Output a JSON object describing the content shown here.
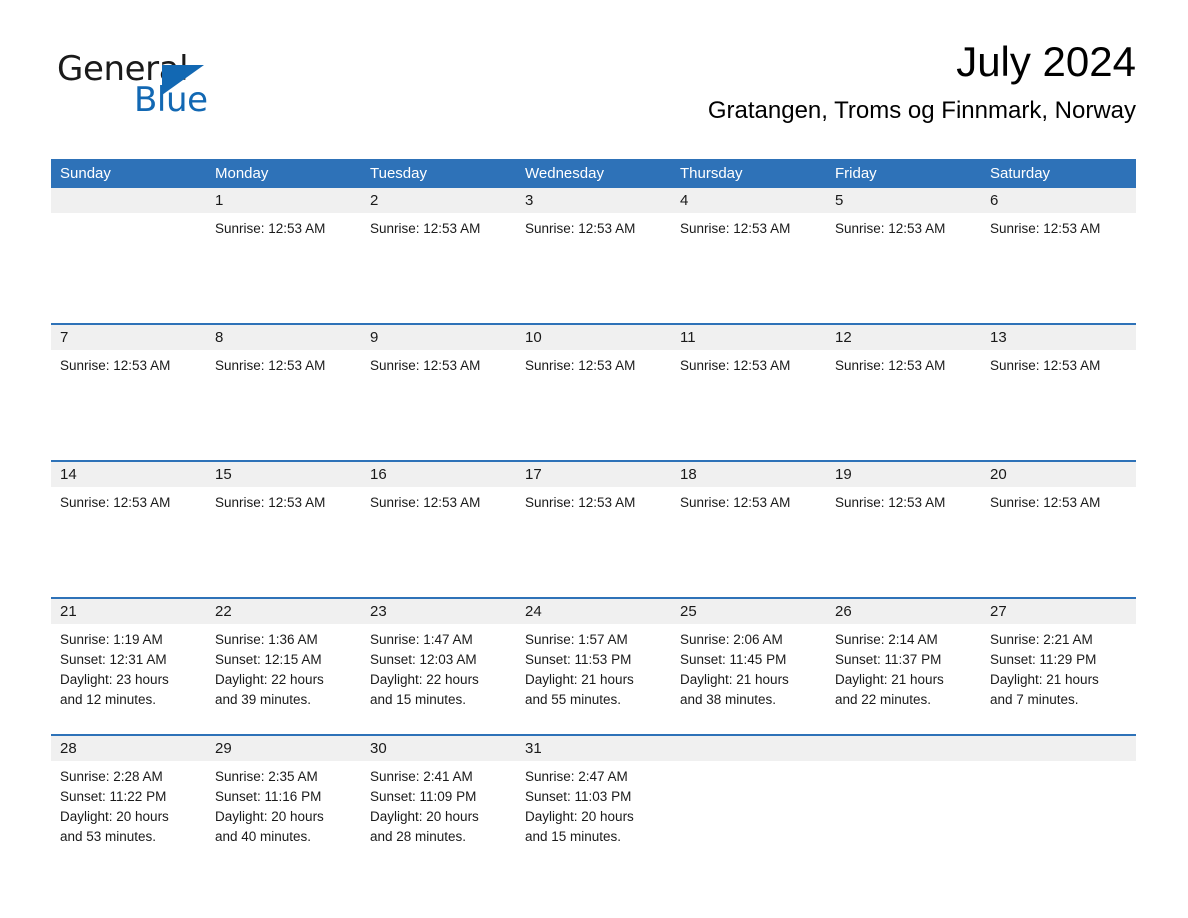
{
  "brand": {
    "name_part1": "General",
    "name_part2": "Blue",
    "triangle_color": "#1268b3",
    "accent_color": "#2e72b8"
  },
  "header": {
    "title": "July 2024",
    "subtitle": "Gratangen, Troms og Finnmark, Norway"
  },
  "calendar": {
    "weekday_headers": [
      "Sunday",
      "Monday",
      "Tuesday",
      "Wednesday",
      "Thursday",
      "Friday",
      "Saturday"
    ],
    "header_bg": "#2e72b8",
    "datebar_bg": "#f0f0f0",
    "weeks": [
      [
        {
          "date": "",
          "lines": []
        },
        {
          "date": "1",
          "lines": [
            "Sunrise: 12:53 AM"
          ]
        },
        {
          "date": "2",
          "lines": [
            "Sunrise: 12:53 AM"
          ]
        },
        {
          "date": "3",
          "lines": [
            "Sunrise: 12:53 AM"
          ]
        },
        {
          "date": "4",
          "lines": [
            "Sunrise: 12:53 AM"
          ]
        },
        {
          "date": "5",
          "lines": [
            "Sunrise: 12:53 AM"
          ]
        },
        {
          "date": "6",
          "lines": [
            "Sunrise: 12:53 AM"
          ]
        }
      ],
      [
        {
          "date": "7",
          "lines": [
            "Sunrise: 12:53 AM"
          ]
        },
        {
          "date": "8",
          "lines": [
            "Sunrise: 12:53 AM"
          ]
        },
        {
          "date": "9",
          "lines": [
            "Sunrise: 12:53 AM"
          ]
        },
        {
          "date": "10",
          "lines": [
            "Sunrise: 12:53 AM"
          ]
        },
        {
          "date": "11",
          "lines": [
            "Sunrise: 12:53 AM"
          ]
        },
        {
          "date": "12",
          "lines": [
            "Sunrise: 12:53 AM"
          ]
        },
        {
          "date": "13",
          "lines": [
            "Sunrise: 12:53 AM"
          ]
        }
      ],
      [
        {
          "date": "14",
          "lines": [
            "Sunrise: 12:53 AM"
          ]
        },
        {
          "date": "15",
          "lines": [
            "Sunrise: 12:53 AM"
          ]
        },
        {
          "date": "16",
          "lines": [
            "Sunrise: 12:53 AM"
          ]
        },
        {
          "date": "17",
          "lines": [
            "Sunrise: 12:53 AM"
          ]
        },
        {
          "date": "18",
          "lines": [
            "Sunrise: 12:53 AM"
          ]
        },
        {
          "date": "19",
          "lines": [
            "Sunrise: 12:53 AM"
          ]
        },
        {
          "date": "20",
          "lines": [
            "Sunrise: 12:53 AM"
          ]
        }
      ],
      [
        {
          "date": "21",
          "lines": [
            "Sunrise: 1:19 AM",
            "Sunset: 12:31 AM",
            "Daylight: 23 hours",
            "and 12 minutes."
          ]
        },
        {
          "date": "22",
          "lines": [
            "Sunrise: 1:36 AM",
            "Sunset: 12:15 AM",
            "Daylight: 22 hours",
            "and 39 minutes."
          ]
        },
        {
          "date": "23",
          "lines": [
            "Sunrise: 1:47 AM",
            "Sunset: 12:03 AM",
            "Daylight: 22 hours",
            "and 15 minutes."
          ]
        },
        {
          "date": "24",
          "lines": [
            "Sunrise: 1:57 AM",
            "Sunset: 11:53 PM",
            "Daylight: 21 hours",
            "and 55 minutes."
          ]
        },
        {
          "date": "25",
          "lines": [
            "Sunrise: 2:06 AM",
            "Sunset: 11:45 PM",
            "Daylight: 21 hours",
            "and 38 minutes."
          ]
        },
        {
          "date": "26",
          "lines": [
            "Sunrise: 2:14 AM",
            "Sunset: 11:37 PM",
            "Daylight: 21 hours",
            "and 22 minutes."
          ]
        },
        {
          "date": "27",
          "lines": [
            "Sunrise: 2:21 AM",
            "Sunset: 11:29 PM",
            "Daylight: 21 hours",
            "and 7 minutes."
          ]
        }
      ],
      [
        {
          "date": "28",
          "lines": [
            "Sunrise: 2:28 AM",
            "Sunset: 11:22 PM",
            "Daylight: 20 hours",
            "and 53 minutes."
          ]
        },
        {
          "date": "29",
          "lines": [
            "Sunrise: 2:35 AM",
            "Sunset: 11:16 PM",
            "Daylight: 20 hours",
            "and 40 minutes."
          ]
        },
        {
          "date": "30",
          "lines": [
            "Sunrise: 2:41 AM",
            "Sunset: 11:09 PM",
            "Daylight: 20 hours",
            "and 28 minutes."
          ]
        },
        {
          "date": "31",
          "lines": [
            "Sunrise: 2:47 AM",
            "Sunset: 11:03 PM",
            "Daylight: 20 hours",
            "and 15 minutes."
          ]
        },
        {
          "date": "",
          "lines": []
        },
        {
          "date": "",
          "lines": []
        },
        {
          "date": "",
          "lines": []
        }
      ]
    ]
  }
}
